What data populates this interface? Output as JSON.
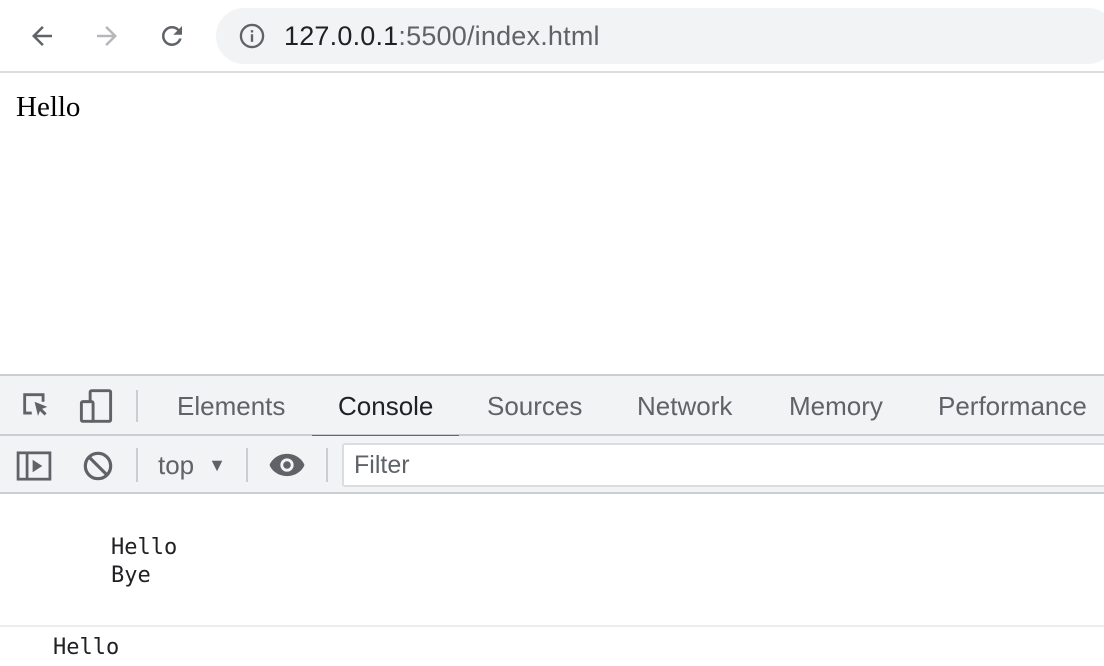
{
  "browser": {
    "url_host": "127.0.0.1",
    "url_rest": ":5500/index.html",
    "icons": {
      "back": "back-arrow-icon",
      "forward": "forward-arrow-icon",
      "reload": "reload-icon",
      "info": "info-icon"
    }
  },
  "page": {
    "text": "Hello"
  },
  "devtools": {
    "tabs": [
      "Elements",
      "Console",
      "Sources",
      "Network",
      "Memory",
      "Performance"
    ],
    "active_tab": "Console",
    "context": "top",
    "filter_placeholder": "Filter",
    "accent_color": "#1a73e8",
    "console_messages": [
      [
        "Hello",
        "Bye"
      ],
      [
        "Hello"
      ]
    ]
  }
}
